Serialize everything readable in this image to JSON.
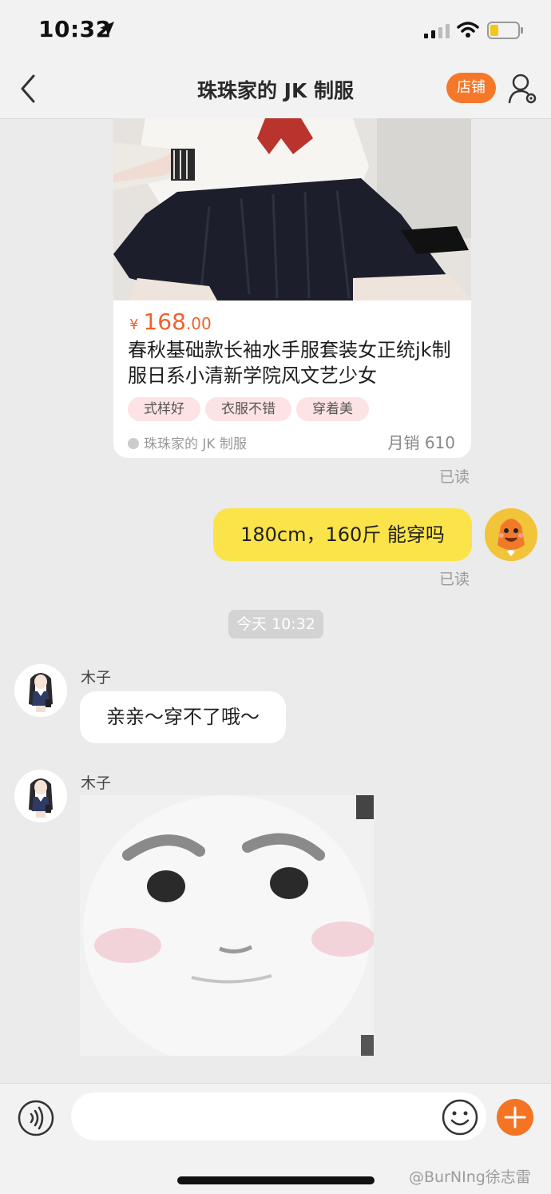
{
  "status_bar": {
    "time": "10:32"
  },
  "nav": {
    "title": "珠珠家的 JK 制服",
    "shop_label": "店铺"
  },
  "product": {
    "currency": "¥",
    "price_int": "168",
    "price_dec": ".00",
    "title": "春秋基础款长袖水手服套装女正统jk制服日系小清新学院风文艺少女",
    "tags": [
      "式样好",
      "衣服不错",
      "穿着美"
    ],
    "store": "珠珠家的 JK 制服",
    "monthly_sales": "月销 610"
  },
  "read_label": "已读",
  "messages": {
    "mine": "180cm，160斤 能穿吗",
    "timestamp": "今天 10:32",
    "seller_name": "木子",
    "seller_text": "亲亲～穿不了哦～"
  },
  "input": {
    "placeholder": ""
  },
  "watermark": "@BurNIng徐志雷",
  "colors": {
    "accent": "#f5772a",
    "my_bubble": "#fbe34a",
    "background": "#ebebeb"
  }
}
